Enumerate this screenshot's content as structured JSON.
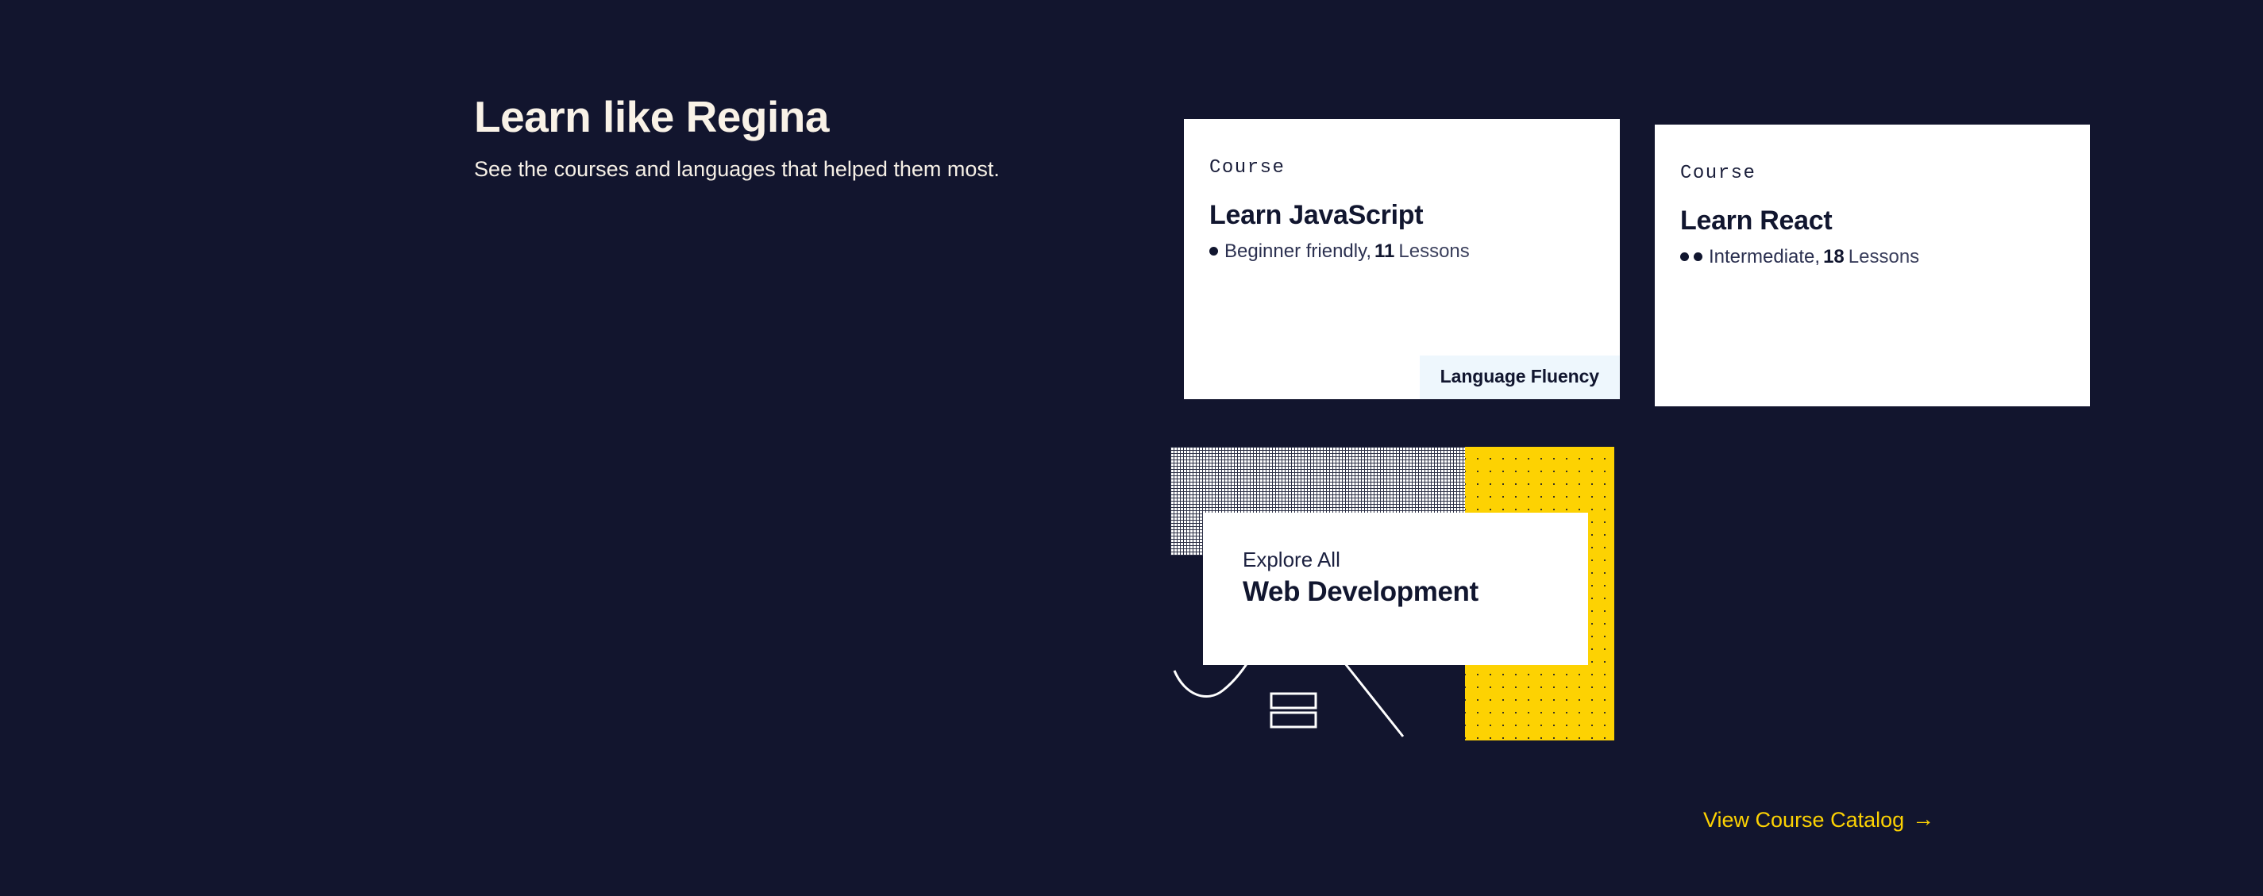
{
  "colors": {
    "background": "#12152e",
    "accent_yellow": "#fdd202",
    "card_white": "#ffffff",
    "tag_blue": "#eef7fd",
    "text_cream": "#f9f2e7",
    "text_navy": "#11162f"
  },
  "intro": {
    "title": "Learn like Regina",
    "subtitle": "See the courses and languages that helped them most."
  },
  "courses": [
    {
      "eyebrow": "Course",
      "title": "Learn JavaScript",
      "level": "Beginner friendly,",
      "level_dots": 1,
      "lesson_count": "11",
      "lesson_word": "Lessons",
      "tag": "Language Fluency"
    },
    {
      "eyebrow": "Course",
      "title": "Learn React",
      "level": "Intermediate,",
      "level_dots": 2,
      "lesson_count": "18",
      "lesson_word": "Lessons",
      "tag": ""
    }
  ],
  "promo": {
    "eyebrow": "Explore All",
    "title": "Web Development"
  },
  "catalog": {
    "label": "View Course Catalog",
    "arrow": "→"
  }
}
